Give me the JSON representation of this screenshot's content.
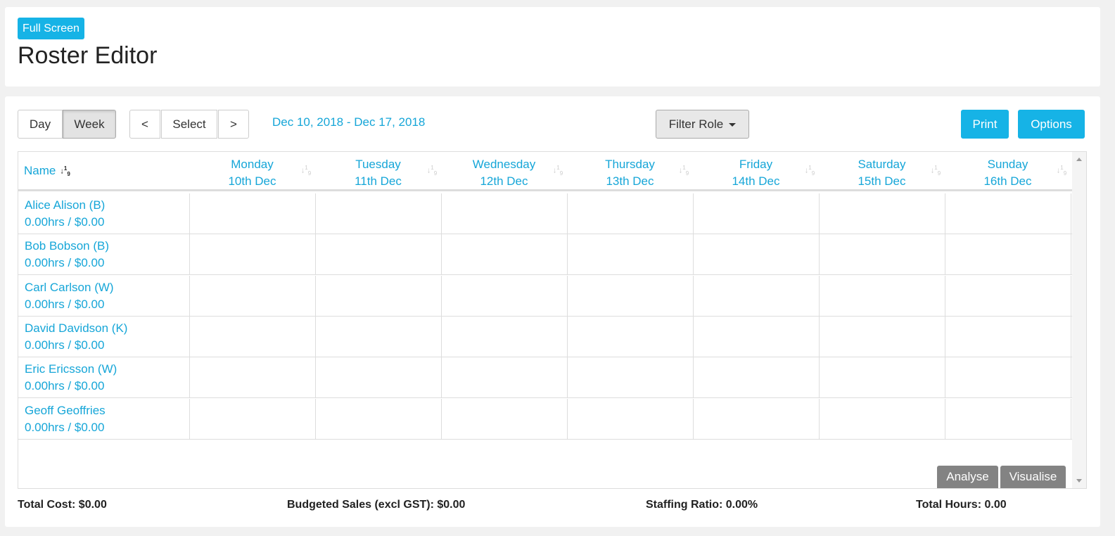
{
  "header": {
    "full_screen_label": "Full Screen",
    "title": "Roster Editor"
  },
  "toolbar": {
    "day_label": "Day",
    "week_label": "Week",
    "prev_label": "<",
    "select_label": "Select",
    "next_label": ">",
    "date_range": "Dec 10, 2018 - Dec 17, 2018",
    "filter_role_label": "Filter Role",
    "print_label": "Print",
    "options_label": "Options"
  },
  "grid": {
    "name_header": "Name",
    "days": [
      {
        "day": "Monday",
        "date": "10th Dec"
      },
      {
        "day": "Tuesday",
        "date": "11th Dec"
      },
      {
        "day": "Wednesday",
        "date": "12th Dec"
      },
      {
        "day": "Thursday",
        "date": "13th Dec"
      },
      {
        "day": "Friday",
        "date": "14th Dec"
      },
      {
        "day": "Saturday",
        "date": "15th Dec"
      },
      {
        "day": "Sunday",
        "date": "16th Dec"
      }
    ],
    "rows": [
      {
        "name": "Alice Alison (B)",
        "summary": "0.00hrs / $0.00"
      },
      {
        "name": "Bob Bobson (B)",
        "summary": "0.00hrs / $0.00"
      },
      {
        "name": "Carl Carlson (W)",
        "summary": "0.00hrs / $0.00"
      },
      {
        "name": "David Davidson (K)",
        "summary": "0.00hrs / $0.00"
      },
      {
        "name": "Eric Ericsson (W)",
        "summary": "0.00hrs / $0.00"
      },
      {
        "name": "Geoff Geoffries",
        "summary": "0.00hrs / $0.00"
      }
    ],
    "analyse_label": "Analyse",
    "visualise_label": "Visualise"
  },
  "footer": {
    "total_cost": "Total Cost: $0.00",
    "budgeted_sales": "Budgeted Sales (excl GST): $0.00",
    "staffing_ratio": "Staffing Ratio: 0.00%",
    "total_hours": "Total Hours: 0.00"
  },
  "colors": {
    "accent": "#16b3e6",
    "link": "#16a6d8",
    "grey_button": "#838383"
  },
  "icons": [
    "sort-numeric-icon",
    "caret-down-icon",
    "scroll-up-icon",
    "scroll-down-icon"
  ]
}
